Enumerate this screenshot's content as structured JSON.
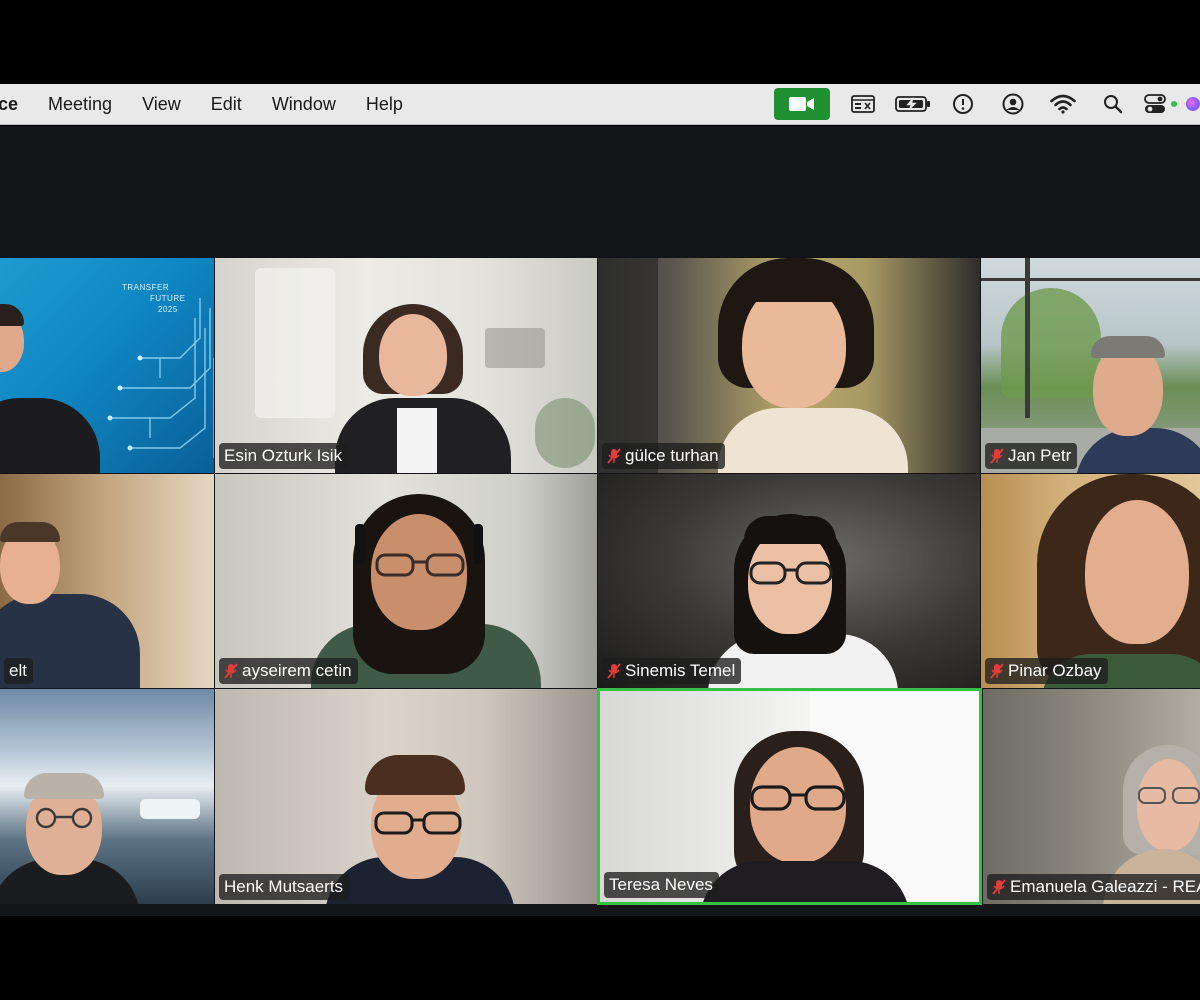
{
  "menubar": {
    "app_fragment": "ce",
    "items": [
      "Meeting",
      "View",
      "Edit",
      "Window",
      "Help"
    ]
  },
  "colors": {
    "zoom_green": "#1f8f32",
    "active_speaker_border": "#34c145",
    "meeting_background": "#121418"
  },
  "participants": [
    {
      "name": "",
      "muted": false
    },
    {
      "name": "Esin Ozturk Isik",
      "muted": false
    },
    {
      "name": "gülce turhan",
      "muted": true
    },
    {
      "name": "Jan Petr",
      "muted": true
    },
    {
      "name": "elt",
      "muted": false
    },
    {
      "name": "ayseirem cetin",
      "muted": true
    },
    {
      "name": "Sinemis Temel",
      "muted": true
    },
    {
      "name": "Pinar Ozbay",
      "muted": true
    },
    {
      "name": "",
      "muted": false
    },
    {
      "name": "Henk Mutsaerts",
      "muted": false
    },
    {
      "name": "Teresa Neves",
      "muted": false,
      "active_speaker": true
    },
    {
      "name": "Emanuela Galeazzi - REA",
      "muted": true
    }
  ],
  "backgrounds": {
    "tile1_text_line1": "TRANSFER",
    "tile1_text_line2": "FUTURE",
    "tile1_text_line3": "2025"
  }
}
